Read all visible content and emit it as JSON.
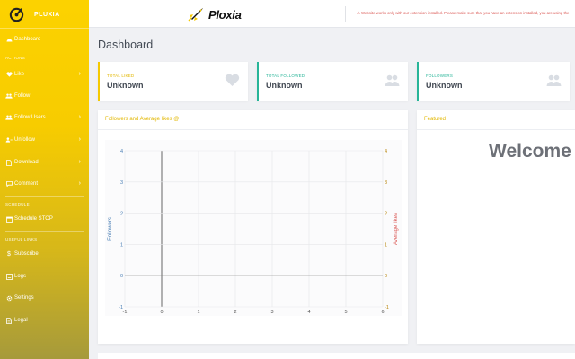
{
  "sidebar": {
    "brand": "PLUXIA",
    "items": [
      {
        "key": "dashboard",
        "label": "Dashboard",
        "icon": "dashboard-icon",
        "chevron": false
      },
      {
        "key": "like",
        "label": "Like",
        "icon": "heart-icon",
        "chevron": true
      },
      {
        "key": "follow",
        "label": "Follow",
        "icon": "users-icon",
        "chevron": false
      },
      {
        "key": "follow-users",
        "label": "Follow Users",
        "icon": "users-icon",
        "chevron": true
      },
      {
        "key": "unfollow",
        "label": "Unfollow",
        "icon": "user-minus-icon",
        "chevron": true
      },
      {
        "key": "download",
        "label": "Download",
        "icon": "file-icon",
        "chevron": true
      },
      {
        "key": "comment",
        "label": "Comment",
        "icon": "comment-icon",
        "chevron": true
      },
      {
        "key": "schedule-stop",
        "label": "Schedule STOP",
        "icon": "calendar-icon",
        "chevron": false
      },
      {
        "key": "subscribe",
        "label": "Subscribe",
        "icon": "dollar-icon",
        "chevron": false
      },
      {
        "key": "logs",
        "label": "Logs",
        "icon": "logs-icon",
        "chevron": false
      },
      {
        "key": "settings",
        "label": "Settings",
        "icon": "gear-icon",
        "chevron": false
      },
      {
        "key": "legal",
        "label": "Legal",
        "icon": "document-icon",
        "chevron": false
      }
    ],
    "sections": {
      "actions": "ACTIONS",
      "schedule": "SCHEDULE",
      "useful_links": "USEFUL LINKS"
    }
  },
  "header": {
    "logo_text": "Ploxia",
    "warning": "⚠ Website works only with our extension installed. Please make sure that you have an extension installed, you are using the"
  },
  "page": {
    "title": "Dashboard"
  },
  "stats": [
    {
      "label": "TOTAL LIKED",
      "value": "Unknown",
      "accent": "#f5c900",
      "icon": "heart-icon"
    },
    {
      "label": "TOTAL FOLLOWED",
      "value": "Unknown",
      "accent": "#28b598",
      "icon": "users-icon"
    },
    {
      "label": "FOLLOWERS",
      "value": "Unknown",
      "accent": "#28b598",
      "icon": "users-icon"
    }
  ],
  "panels": {
    "chart_title": "Followers and Average likes @",
    "featured_title": "Featured",
    "welcome": "Welcome"
  },
  "chart_data": {
    "type": "line",
    "x_ticks": [
      "-1",
      "0",
      "1",
      "2",
      "3",
      "4",
      "5",
      "6"
    ],
    "y_left_ticks": [
      "4",
      "3",
      "2",
      "1",
      "0",
      "-1"
    ],
    "y_right_ticks": [
      "4",
      "3",
      "2",
      "1",
      "0",
      "-1"
    ],
    "ylabel_left": "Followers",
    "ylabel_right": "Average likes",
    "xlim": [
      -1,
      6
    ],
    "ylim": [
      -1,
      4
    ],
    "grid": true,
    "series": []
  },
  "colors": {
    "sidebar_top": "#fcd200",
    "accent_yellow": "#f5c900",
    "accent_teal": "#28b598",
    "warning_red": "#d9534f",
    "left_axis_blue": "#4a7fb5",
    "right_axis_red": "#d9534f"
  }
}
